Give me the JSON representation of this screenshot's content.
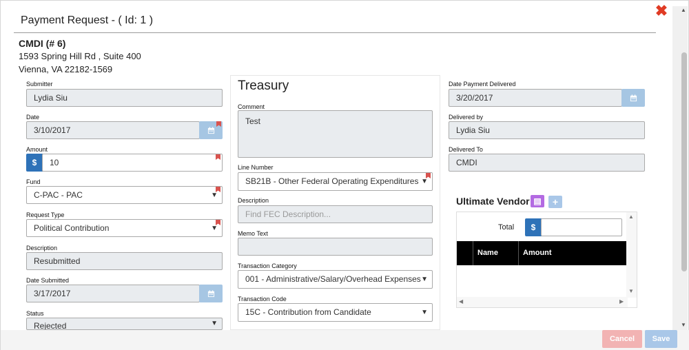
{
  "dialog": {
    "title": "Payment Request - ( Id: 1 )"
  },
  "organization": {
    "name": "CMDI (# 6)",
    "address1": "1593 Spring Hill Rd , Suite 400",
    "address2": "Vienna, VA 22182-1569"
  },
  "left": {
    "submitter": {
      "label": "Submitter",
      "value": "Lydia Siu"
    },
    "date": {
      "label": "Date",
      "value": "3/10/2017"
    },
    "amount": {
      "label": "Amount",
      "currency": "$",
      "value": "10"
    },
    "fund": {
      "label": "Fund",
      "value": "C-PAC - PAC"
    },
    "request_type": {
      "label": "Request Type",
      "value": "Political Contribution"
    },
    "description": {
      "label": "Description",
      "value": "Resubmitted"
    },
    "date_submitted": {
      "label": "Date Submitted",
      "value": "3/17/2017"
    },
    "status": {
      "label": "Status",
      "value": "Rejected"
    }
  },
  "treasury": {
    "title": "Treasury",
    "comment": {
      "label": "Comment",
      "value": "Test"
    },
    "line_number": {
      "label": "Line Number",
      "value": "SB21B - Other Federal Operating Expenditures"
    },
    "description": {
      "label": "Description",
      "placeholder": "Find FEC Description..."
    },
    "memo_text": {
      "label": "Memo Text",
      "value": ""
    },
    "transaction_category": {
      "label": "Transaction Category",
      "value": "001 - Administrative/Salary/Overhead Expenses"
    },
    "transaction_code": {
      "label": "Transaction Code",
      "value": "15C - Contribution from Candidate"
    }
  },
  "right": {
    "date_payment_delivered": {
      "label": "Date Payment Delivered",
      "value": "3/20/2017"
    },
    "delivered_by": {
      "label": "Delivered by",
      "value": "Lydia Siu"
    },
    "delivered_to": {
      "label": "Delivered To",
      "value": "CMDI"
    }
  },
  "vendor": {
    "title": "Ultimate Vendor",
    "total_label": "Total",
    "currency": "$",
    "total_value": "",
    "columns": [
      "Name",
      "Amount"
    ]
  },
  "footer": {
    "cancel": "Cancel",
    "save": "Save"
  },
  "colors": {
    "close": "#e03b24",
    "primary": "#2e72b8",
    "calendar": "#a6c6e3",
    "flag": "#d9534f",
    "purple": "#b36ae2",
    "cancel": "#f2b3b3",
    "save": "#a9c7e8"
  }
}
